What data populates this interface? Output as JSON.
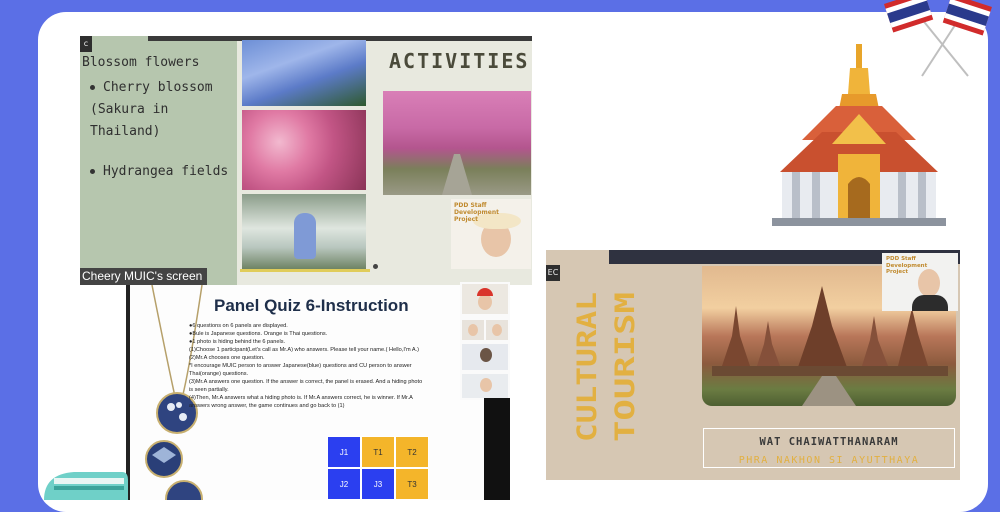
{
  "slide1": {
    "tag": "c",
    "title": "Blossom flowers",
    "bullet1": "Cherry blossom (Sakura in Thailand)",
    "bullet2": "Hydrangea fields",
    "heading": "ACTIVITIES",
    "project_label": "PDD Staff Development Project",
    "screen_label": "Cheery  MUIC's screen"
  },
  "slide2": {
    "title": "Panel Quiz 6-Instruction",
    "lines": [
      "●6 questions on 6 panels are displayed.",
      "●Bule is Japanese questions. Orange is Thai questions.",
      "●1 photo is hiding behind the 6 panels.",
      "(1)Choose 1 participant(Let's call as Mr.A) who answers. Please tell your name.( Hello,I'm A.)",
      "(2)Mr.A chooses one question.",
      "   *I encourage MUIC person to answer Japanese(blue) questions and CU person to answer",
      "   Thai(orange) questions.",
      "(3)Mr.A answers one question. If the answer is correct, the panel is erased. And a hiding photo",
      "   is seen partially.",
      "(4)Then, Mr.A answers what a hiding photo is. If Mr.A answers correct, he is winner. If Mr.A",
      "   answers wrong answer, the game continues and go back to (1)"
    ],
    "panels": [
      {
        "label": "J1",
        "kind": "J"
      },
      {
        "label": "T1",
        "kind": "T"
      },
      {
        "label": "T2",
        "kind": "T"
      },
      {
        "label": "J2",
        "kind": "J"
      },
      {
        "label": "J3",
        "kind": "J"
      },
      {
        "label": "T3",
        "kind": "T"
      }
    ]
  },
  "slide3": {
    "tag": "EC",
    "vertical_title": "CULTURAL TOURISM",
    "line1": "WAT CHAIWATTHANARAM",
    "line2": "PHRA NAKHON SI AYUTTHAYA",
    "project_label": "PDD Staff Development Project"
  },
  "icons": [
    "thai-flag-icon",
    "thai-temple-icon",
    "tuk-tuk-icon"
  ],
  "colors": {
    "background": "#5b6fe6",
    "japanese_panel": "#2b3ff0",
    "thai_panel": "#f4b52a",
    "accent_gold": "#e2b041"
  }
}
